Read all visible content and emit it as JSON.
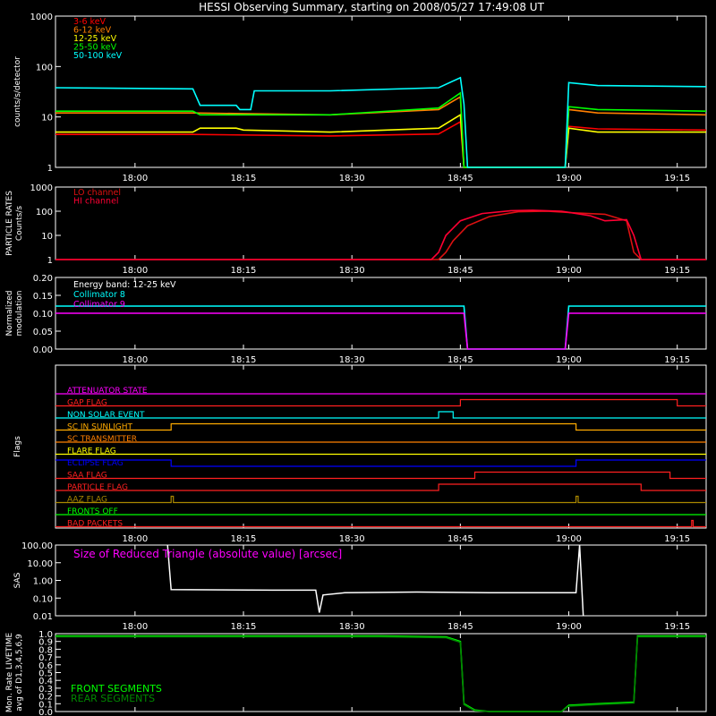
{
  "title": "HESSI Observing Summary, starting on 2008/05/27 17:49:08 UT",
  "time_ticks": [
    "18:00",
    "18:15",
    "18:30",
    "18:45",
    "19:00",
    "19:15"
  ],
  "chart_data": [
    {
      "id": "counts",
      "type": "line",
      "ylabel": "counts/s/detector",
      "yscale": "log",
      "ylim": [
        1,
        1000
      ],
      "ytick_labels": [
        "1000",
        "100",
        "10",
        "1"
      ],
      "series": [
        {
          "name": "3-6 keV",
          "color": "#ff0000",
          "points": [
            [
              0,
              4.5
            ],
            [
              19,
              4.5
            ],
            [
              38,
              4.2
            ],
            [
              53,
              4.6
            ],
            [
              56,
              8
            ],
            [
              56.5,
              0.5
            ],
            [
              70.5,
              0.5
            ],
            [
              71,
              6.5
            ],
            [
              75,
              5.8
            ],
            [
              90,
              5.5
            ]
          ]
        },
        {
          "name": "6-12 keV",
          "color": "#ff7f00",
          "points": [
            [
              0,
              12
            ],
            [
              19,
              12
            ],
            [
              38,
              11
            ],
            [
              53,
              14
            ],
            [
              56,
              25
            ],
            [
              56.5,
              0.5
            ],
            [
              70.5,
              0.5
            ],
            [
              71,
              14
            ],
            [
              75,
              12
            ],
            [
              90,
              11
            ]
          ]
        },
        {
          "name": "12-25 keV",
          "color": "#ffff00",
          "points": [
            [
              0,
              5
            ],
            [
              19,
              5
            ],
            [
              20,
              6
            ],
            [
              25,
              6
            ],
            [
              26,
              5.5
            ],
            [
              38,
              5
            ],
            [
              53,
              6
            ],
            [
              56,
              11
            ],
            [
              56.5,
              0.5
            ],
            [
              70.5,
              0.5
            ],
            [
              71,
              6
            ],
            [
              75,
              5
            ],
            [
              90,
              5
            ]
          ]
        },
        {
          "name": "25-50 keV",
          "color": "#00ff00",
          "points": [
            [
              0,
              13
            ],
            [
              19,
              13
            ],
            [
              20,
              11
            ],
            [
              38,
              11
            ],
            [
              53,
              15
            ],
            [
              56,
              30
            ],
            [
              56.5,
              0.5
            ],
            [
              70.5,
              0.5
            ],
            [
              71,
              16
            ],
            [
              75,
              14
            ],
            [
              90,
              13
            ]
          ]
        },
        {
          "name": "50-100 keV",
          "color": "#00ffff",
          "points": [
            [
              0,
              38
            ],
            [
              19,
              36
            ],
            [
              20,
              17
            ],
            [
              25,
              17
            ],
            [
              25.5,
              14
            ],
            [
              27,
              14
            ],
            [
              27.5,
              33
            ],
            [
              38,
              33
            ],
            [
              53,
              38
            ],
            [
              56,
              60
            ],
            [
              56.5,
              18
            ],
            [
              57,
              0.5
            ],
            [
              70.5,
              0.5
            ],
            [
              71,
              48
            ],
            [
              75,
              42
            ],
            [
              90,
              40
            ]
          ]
        }
      ]
    },
    {
      "id": "particle",
      "type": "line",
      "ylabel": "PARTICLE RATES Counts/s",
      "yscale": "log",
      "ylim": [
        1,
        1000
      ],
      "ytick_labels": [
        "1000",
        "100",
        "10",
        "1"
      ],
      "series": [
        {
          "name": "LO channel",
          "color": "#dd1111",
          "points": [
            [
              0,
              1
            ],
            [
              53,
              1
            ],
            [
              54,
              2
            ],
            [
              55,
              6
            ],
            [
              57,
              25
            ],
            [
              60,
              60
            ],
            [
              64,
              95
            ],
            [
              68,
              100
            ],
            [
              72,
              85
            ],
            [
              76,
              75
            ],
            [
              79,
              40
            ],
            [
              80,
              2
            ],
            [
              81,
              1
            ],
            [
              90,
              1
            ]
          ]
        },
        {
          "name": "HI channel",
          "color": "#ff0033",
          "points": [
            [
              0,
              1
            ],
            [
              52,
              1
            ],
            [
              53,
              2
            ],
            [
              54,
              10
            ],
            [
              56,
              40
            ],
            [
              59,
              80
            ],
            [
              63,
              105
            ],
            [
              66,
              110
            ],
            [
              70,
              100
            ],
            [
              74,
              65
            ],
            [
              76,
              40
            ],
            [
              79,
              45
            ],
            [
              80,
              10
            ],
            [
              81,
              1
            ],
            [
              90,
              1
            ]
          ]
        }
      ]
    },
    {
      "id": "modulation",
      "type": "line",
      "ylabel": "Normalized modulation",
      "ylim": [
        0,
        0.2
      ],
      "ytick_labels": [
        "0.20",
        "0.15",
        "0.10",
        "0.05",
        "0.00"
      ],
      "annotations": [
        "Energy band: 12-25 keV"
      ],
      "series": [
        {
          "name": "Collimator 8",
          "color": "#00ffff",
          "points": [
            [
              0,
              0.12
            ],
            [
              56.5,
              0.12
            ],
            [
              57,
              0
            ],
            [
              70.5,
              0
            ],
            [
              71,
              0.12
            ],
            [
              90,
              0.12
            ]
          ]
        },
        {
          "name": "Collimator 9",
          "color": "#ff00ff",
          "points": [
            [
              0,
              0.1
            ],
            [
              56.5,
              0.1
            ],
            [
              57,
              0
            ],
            [
              70.5,
              0
            ],
            [
              71,
              0.1
            ],
            [
              90,
              0.1
            ]
          ]
        }
      ]
    },
    {
      "id": "flags",
      "type": "line",
      "ylabel": "Flags",
      "series": [
        {
          "name": "ATTENUATOR STATE",
          "color": "#ff00ff",
          "points": [
            [
              0,
              0
            ],
            [
              90,
              0
            ]
          ]
        },
        {
          "name": "GAP FLAG",
          "color": "#ff2020",
          "points": [
            [
              0,
              0
            ],
            [
              56,
              0
            ],
            [
              56,
              1
            ],
            [
              86,
              1
            ],
            [
              86,
              0
            ],
            [
              90,
              0
            ]
          ]
        },
        {
          "name": "NON SOLAR EVENT",
          "color": "#00ffff",
          "points": [
            [
              0,
              0
            ],
            [
              53,
              0
            ],
            [
              53,
              1
            ],
            [
              55,
              1
            ],
            [
              55,
              0
            ],
            [
              90,
              0
            ]
          ]
        },
        {
          "name": "SC IN SUNLIGHT",
          "color": "#ffaa00",
          "points": [
            [
              0,
              0
            ],
            [
              16,
              0
            ],
            [
              16,
              1
            ],
            [
              72,
              1
            ],
            [
              72,
              0
            ],
            [
              90,
              0
            ]
          ]
        },
        {
          "name": "SC TRANSMITTER",
          "color": "#ff7f00",
          "points": [
            [
              0,
              0
            ],
            [
              90,
              0
            ]
          ]
        },
        {
          "name": "FLARE FLAG",
          "color": "#ffff00",
          "points": [
            [
              0,
              0
            ],
            [
              90,
              0
            ]
          ]
        },
        {
          "name": "ECLIPSE FLAG",
          "color": "#0000ff",
          "points": [
            [
              0,
              1
            ],
            [
              16,
              1
            ],
            [
              16,
              0
            ],
            [
              72,
              0
            ],
            [
              72,
              1
            ],
            [
              90,
              1
            ]
          ]
        },
        {
          "name": "SAA FLAG",
          "color": "#ff2020",
          "points": [
            [
              0,
              0
            ],
            [
              58,
              0
            ],
            [
              58,
              1
            ],
            [
              85,
              1
            ],
            [
              85,
              0
            ],
            [
              90,
              0
            ]
          ]
        },
        {
          "name": "PARTICLE FLAG",
          "color": "#ff2020",
          "points": [
            [
              0,
              0
            ],
            [
              53,
              0
            ],
            [
              53,
              1
            ],
            [
              81,
              1
            ],
            [
              81,
              0
            ],
            [
              90,
              0
            ]
          ]
        },
        {
          "name": "AAZ FLAG",
          "color": "#aa8800",
          "points": [
            [
              0,
              0
            ],
            [
              16,
              0
            ],
            [
              16,
              1
            ],
            [
              16.3,
              1
            ],
            [
              16.3,
              0
            ],
            [
              72,
              0
            ],
            [
              72,
              1
            ],
            [
              72.3,
              1
            ],
            [
              72.3,
              0
            ],
            [
              90,
              0
            ]
          ]
        },
        {
          "name": "FRONTS OFF",
          "color": "#00ff00",
          "points": [
            [
              0,
              0
            ],
            [
              90,
              0
            ]
          ]
        },
        {
          "name": "BAD PACKETS",
          "color": "#ff2020",
          "points": [
            [
              0,
              0
            ],
            [
              88,
              0
            ],
            [
              88,
              1
            ],
            [
              88.2,
              1
            ],
            [
              88.2,
              0
            ],
            [
              90,
              0
            ]
          ]
        }
      ]
    },
    {
      "id": "sas",
      "type": "line",
      "ylabel": "SAS",
      "yscale": "log",
      "ylim": [
        0.01,
        100
      ],
      "ytick_labels": [
        "100.00",
        "10.00",
        "1.00",
        "0.10",
        "0.01"
      ],
      "annotations": [
        "Size of Reduced Triangle (absolute value) [arcsec]"
      ],
      "series": [
        {
          "name": "Size of Reduced Triangle",
          "color": "#ffffff",
          "points": [
            [
              15.5,
              100
            ],
            [
              16,
              0.3
            ],
            [
              30,
              0.28
            ],
            [
              36,
              0.28
            ],
            [
              36.5,
              0.015
            ],
            [
              37,
              0.15
            ],
            [
              40,
              0.2
            ],
            [
              50,
              0.22
            ],
            [
              60,
              0.2
            ],
            [
              72,
              0.2
            ],
            [
              72.5,
              100
            ],
            [
              73,
              0.01
            ]
          ]
        }
      ]
    },
    {
      "id": "livetime",
      "type": "line",
      "ylabel": "Mon. Rate LIVETIME avg of D1,3,4,5,6,9",
      "ylim": [
        0,
        1.0
      ],
      "ytick_labels": [
        "1.0",
        "0.9",
        "0.8",
        "0.7",
        "0.6",
        "0.5",
        "0.4",
        "0.3",
        "0.2",
        "0.1",
        "0.0"
      ],
      "series": [
        {
          "name": "FRONT SEGMENTS",
          "color": "#00ff00",
          "points": [
            [
              0,
              0.97
            ],
            [
              45,
              0.97
            ],
            [
              54,
              0.96
            ],
            [
              56,
              0.9
            ],
            [
              56.5,
              0.1
            ],
            [
              58,
              0.02
            ],
            [
              60,
              0
            ],
            [
              70,
              0
            ],
            [
              71,
              0.08
            ],
            [
              75,
              0.1
            ],
            [
              80,
              0.12
            ],
            [
              80.5,
              0.97
            ],
            [
              90,
              0.97
            ]
          ]
        },
        {
          "name": "REAR SEGMENTS",
          "color": "#008800",
          "points": [
            [
              0,
              0.96
            ],
            [
              45,
              0.96
            ],
            [
              54,
              0.95
            ],
            [
              56,
              0.89
            ],
            [
              56.5,
              0.09
            ],
            [
              58,
              0.01
            ],
            [
              60,
              0
            ],
            [
              70,
              0
            ],
            [
              71,
              0.07
            ],
            [
              75,
              0.09
            ],
            [
              80,
              0.11
            ],
            [
              80.5,
              0.96
            ],
            [
              90,
              0.96
            ]
          ]
        }
      ]
    }
  ]
}
